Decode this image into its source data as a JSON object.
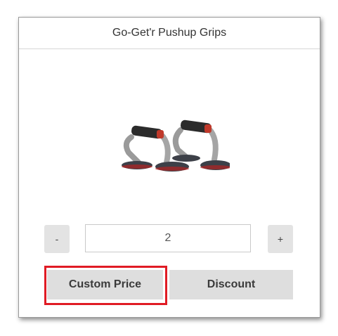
{
  "product": {
    "title": "Go-Get'r Pushup Grips"
  },
  "quantity": {
    "minus_label": "-",
    "value": "2",
    "plus_label": "+"
  },
  "actions": {
    "custom_price_label": "Custom Price",
    "discount_label": "Discount"
  },
  "colors": {
    "highlight": "#e01b24",
    "button_bg": "#dedede"
  }
}
